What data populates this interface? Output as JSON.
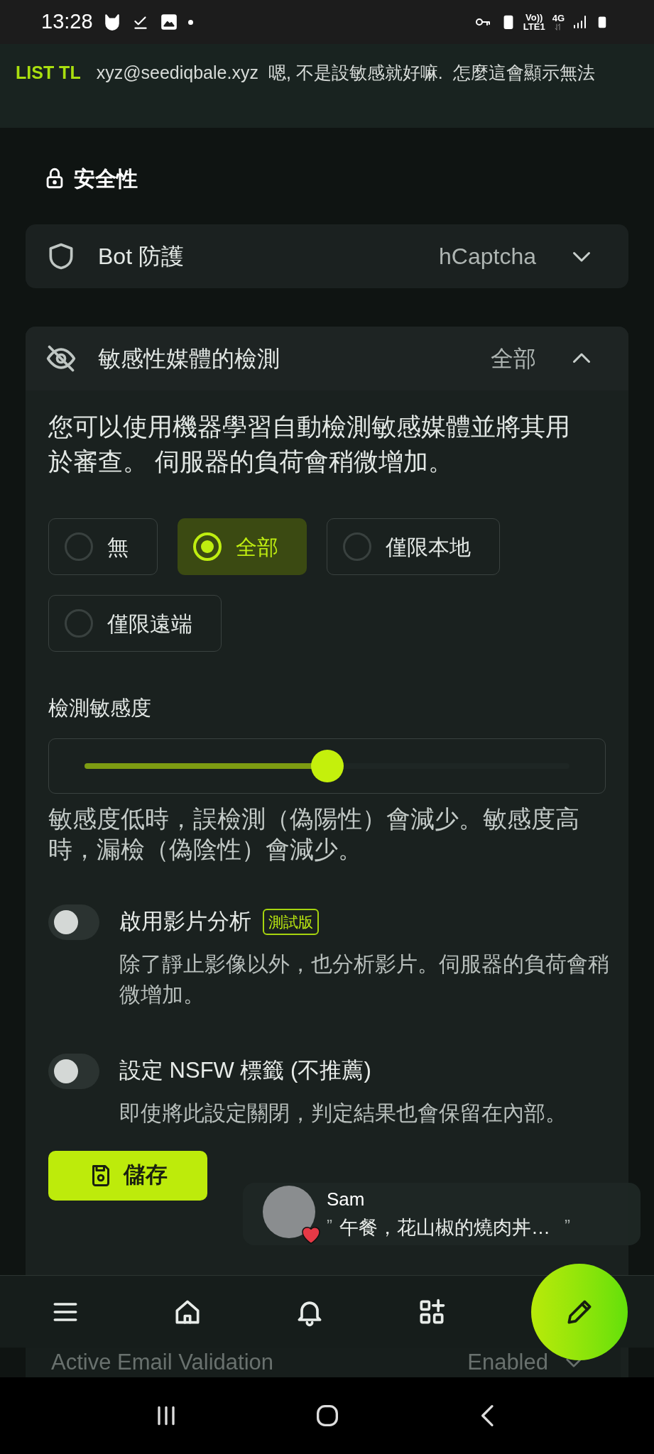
{
  "status_bar": {
    "time": "13:28",
    "network_texts": [
      "Vo))",
      "LTE1",
      "4G"
    ]
  },
  "ticker": {
    "label": "LIST TL",
    "account": "xyz@seediqbale.xyz",
    "text": "嗯, 不是設敏感就好嘛.  怎麼這會顯示無法"
  },
  "section_title": "安全性",
  "bot_protection": {
    "label": "Bot 防護",
    "value": "hCaptcha",
    "expanded": false
  },
  "sensitive_media": {
    "label": "敏感性媒體的檢測",
    "value": "全部",
    "expanded": true,
    "description": "您可以使用機器學習自動檢測敏感媒體並將其用於審查。 伺服器的負荷會稍微增加。",
    "options": [
      {
        "label": "無",
        "selected": false
      },
      {
        "label": "全部",
        "selected": true
      },
      {
        "label": "僅限本地",
        "selected": false
      },
      {
        "label": "僅限遠端",
        "selected": false
      }
    ],
    "sensitivity": {
      "label": "檢測敏感度",
      "level": 0.5
    },
    "sensitivity_hint": "敏感度低時，誤檢測（偽陽性）會減少。敏感度高時，漏檢（偽陰性）會減少。",
    "toggles": [
      {
        "label": "啟用影片分析",
        "badge": "測試版",
        "description": "除了靜止影像以外，也分析影片。伺服器的負荷會稍微增加。",
        "on": false
      },
      {
        "label": "設定 NSFW 標籤 (不推薦)",
        "description": "即使將此設定關閉，判定結果也會保留在內部。",
        "on": false
      }
    ]
  },
  "save_button": "儲存",
  "next_row": {
    "label": "Active Email Validation",
    "value": "Enabled",
    "expanded": false
  },
  "notification": {
    "name": "Sam",
    "open_quote": "”",
    "text": "午餐，花山椒的燒肉丼…",
    "close_quote": "”"
  }
}
